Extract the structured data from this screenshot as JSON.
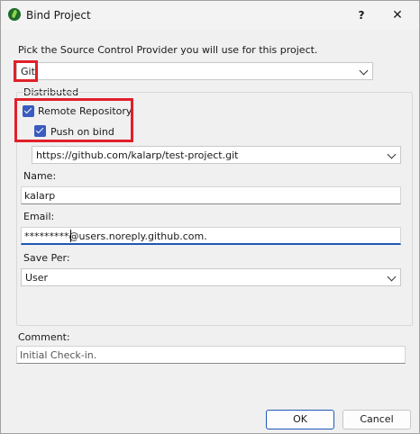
{
  "window": {
    "title": "Bind Project",
    "help_glyph": "?",
    "close_glyph": "✕"
  },
  "provider": {
    "prompt": "Pick the Source Control Provider you will use for this project.",
    "selected": "Git"
  },
  "distributed": {
    "group_label": "Distributed",
    "remote_repository_label": "Remote Repository:",
    "push_on_bind_label": "Push on bind",
    "repository_url": "https://github.com/kalarp/test-project.git",
    "name_label": "Name:",
    "name_value": "kalarp",
    "email_label": "Email:",
    "email_value": "*********@users.noreply.github.com.",
    "save_per_label": "Save Per:",
    "save_per_value": "User"
  },
  "comment": {
    "label": "Comment:",
    "placeholder": "Initial Check-in."
  },
  "buttons": {
    "ok": "OK",
    "cancel": "Cancel"
  },
  "colors": {
    "accent": "#3a5bbf",
    "highlight": "#e0202a",
    "focus": "#1e56b3"
  }
}
